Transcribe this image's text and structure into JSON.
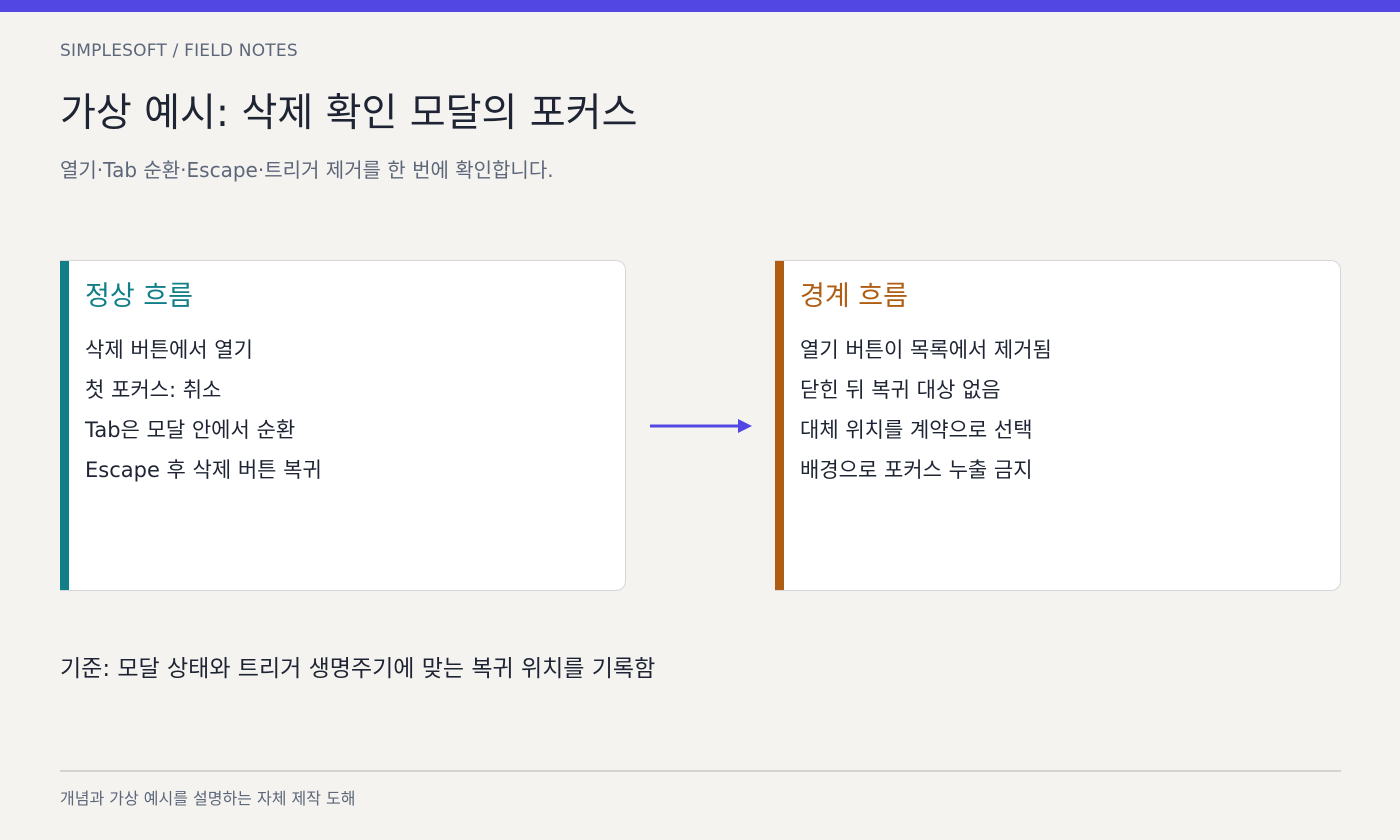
{
  "header": {
    "breadcrumb": "SIMPLESOFT / FIELD NOTES",
    "title": "가상 예시: 삭제 확인 모달의 포커스",
    "subtitle": "열기·Tab 순환·Escape·트리거 제거를 한 번에 확인합니다."
  },
  "cards": [
    {
      "title": "정상 흐름",
      "accent_color": "#127f88",
      "items": [
        "삭제 버튼에서 열기",
        "첫 포커스: 취소",
        "Tab은 모달 안에서 순환",
        "Escape 후 삭제 버튼 복귀"
      ]
    },
    {
      "title": "경계 흐름",
      "accent_color": "#b05d14",
      "items": [
        "열기 버튼이 목록에서 제거됨",
        "닫힌 뒤 복귀 대상 없음",
        "대체 위치를 계약으로 선택",
        "배경으로 포커스 누출 금지"
      ]
    }
  ],
  "connector": {
    "icon": "arrow-right-icon",
    "color": "#5347e4"
  },
  "criterion": "기준: 모달 상태와 트리거 생명주기에 맞는 복귀 위치를 기록함",
  "footer": {
    "note": "개념과 가상 예시를 설명하는 자체 제작 도해"
  },
  "colors": {
    "top_bar": "#5347e4",
    "background": "#f4f3f0"
  }
}
